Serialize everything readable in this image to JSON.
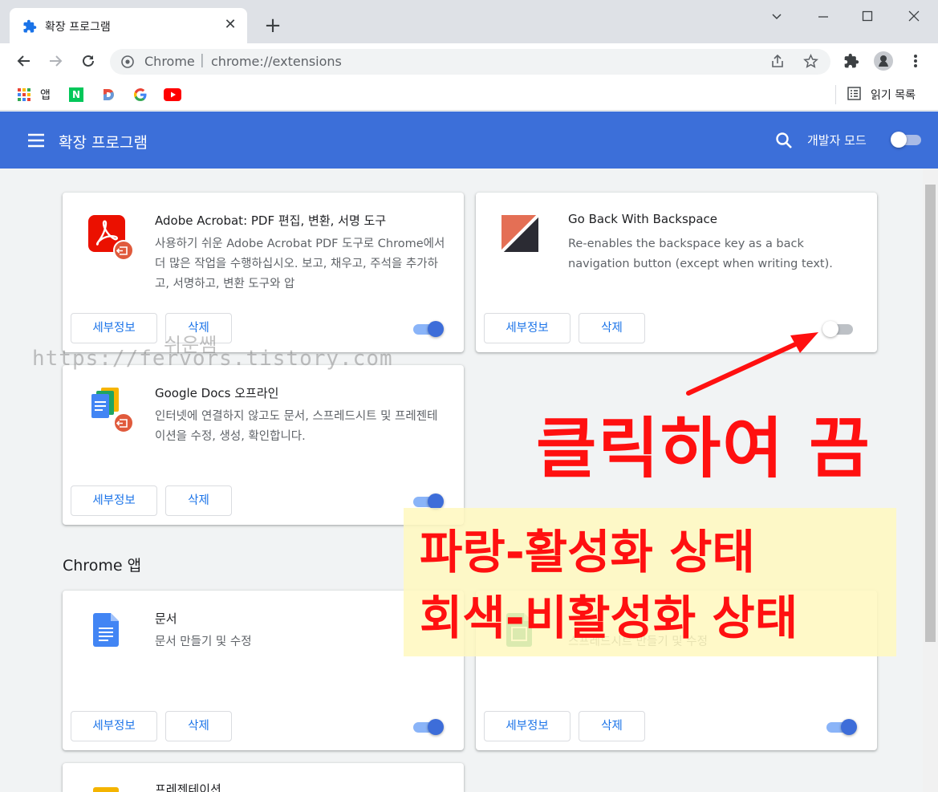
{
  "browser": {
    "tab_title": "확장 프로그램",
    "new_tab_symbol": "+",
    "omnibox": {
      "site_label": "Chrome",
      "separator": "|",
      "url": "chrome://extensions"
    },
    "bookmarks": [
      {
        "label": "앱",
        "icon": "apps-grid-icon"
      },
      {
        "label": "",
        "icon": "naver-icon"
      },
      {
        "label": "",
        "icon": "daum-icon"
      },
      {
        "label": "",
        "icon": "google-icon"
      },
      {
        "label": "",
        "icon": "youtube-icon"
      }
    ],
    "reading_list_label": "읽기 목록"
  },
  "header": {
    "title": "확장 프로그램",
    "dev_mode_label": "개발자 모드",
    "dev_mode_enabled": false
  },
  "extensions": [
    {
      "name": "Adobe Acrobat: PDF 편집, 변환, 서명 도구",
      "description": "사용하기 쉬운 Adobe Acrobat PDF 도구로 Chrome에서 더 많은 작업을 수행하십시오. 보고, 채우고, 주석을 추가하고, 서명하고, 변환 도구와 압",
      "icon": "adobe-acrobat-icon",
      "details_label": "세부정보",
      "remove_label": "삭제",
      "enabled": true
    },
    {
      "name": "Go Back With Backspace",
      "description": "Re-enables the backspace key as a back navigation button (except when writing text).",
      "icon": "go-back-backspace-icon",
      "details_label": "세부정보",
      "remove_label": "삭제",
      "enabled": false
    },
    {
      "name": "Google Docs 오프라인",
      "description": "인터넷에 연결하지 않고도 문서, 스프레드시트 및 프레젠테이션을 수정, 생성, 확인합니다.",
      "icon": "google-docs-offline-icon",
      "details_label": "세부정보",
      "remove_label": "삭제",
      "enabled": true
    }
  ],
  "apps_section": {
    "title": "Chrome 앱",
    "apps": [
      {
        "name": "문서",
        "description": "문서 만들기 및 수정",
        "icon": "google-docs-icon",
        "details_label": "세부정보",
        "remove_label": "삭제",
        "enabled": true
      },
      {
        "name": "",
        "description": "스프레드시트 만들기 및 수정",
        "icon": "google-sheets-icon",
        "details_label": "세부정보",
        "remove_label": "삭제",
        "enabled": true
      },
      {
        "name": "프레젠테이션",
        "icon": "google-slides-icon"
      }
    ]
  },
  "annotations": {
    "watermark_line1": "쉬운쌤",
    "watermark_line2": "https://fervors.tistory.com",
    "click_label": "클릭하여 끔",
    "legend_line1": "파랑-활성화 상태",
    "legend_line2": "회색-비활성화 상태",
    "annotation_color": "#ff1010"
  },
  "colors": {
    "header_blue": "#3c6fd9",
    "toggle_on": "#3d6dd9",
    "toggle_track_on": "#8ab4f8",
    "toggle_off_track": "#bdc1c6",
    "link_blue": "#1a73e8"
  }
}
